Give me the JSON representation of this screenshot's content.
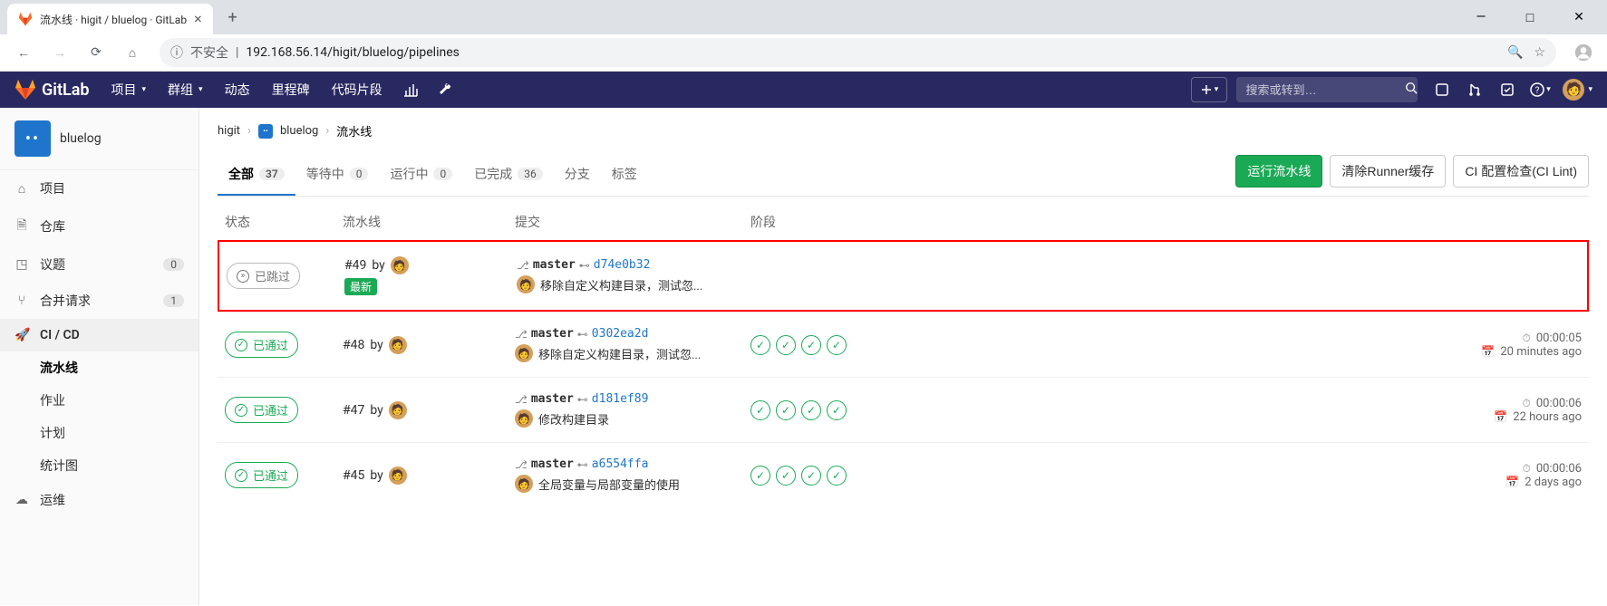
{
  "browser": {
    "tab_title": "流水线 · higit / bluelog · GitLab",
    "insecure_label": "不安全",
    "url": "192.168.56.14/higit/bluelog/pipelines"
  },
  "topbar": {
    "brand": "GitLab",
    "nav": {
      "projects": "项目",
      "groups": "群组",
      "activity": "动态",
      "milestones": "里程碑",
      "snippets": "代码片段"
    },
    "search_placeholder": "搜索或转到…"
  },
  "sidebar": {
    "project_name": "bluelog",
    "items": {
      "project": "项目",
      "repo": "仓库",
      "issues": {
        "label": "议题",
        "count": "0"
      },
      "mrs": {
        "label": "合并请求",
        "count": "1"
      },
      "cicd": "CI / CD",
      "ops": "运维"
    },
    "cicd_sub": {
      "pipelines": "流水线",
      "jobs": "作业",
      "schedules": "计划",
      "charts": "统计图"
    }
  },
  "breadcrumb": {
    "group": "higit",
    "project": "bluelog",
    "page": "流水线"
  },
  "tabs": {
    "all": {
      "label": "全部",
      "count": "37"
    },
    "pending": {
      "label": "等待中",
      "count": "0"
    },
    "running": {
      "label": "运行中",
      "count": "0"
    },
    "finished": {
      "label": "已完成",
      "count": "36"
    },
    "branches": "分支",
    "tags": "标签"
  },
  "buttons": {
    "run": "运行流水线",
    "clear_cache": "清除Runner缓存",
    "ci_lint": "CI 配置检查(CI Lint)"
  },
  "columns": {
    "status": "状态",
    "pipeline": "流水线",
    "commit": "提交",
    "stages": "阶段"
  },
  "status_labels": {
    "skipped": "已跳过",
    "passed": "已通过"
  },
  "latest_label": "最新",
  "by_label": "by",
  "branch_default": "master",
  "pipelines": [
    {
      "status": "skipped",
      "id": "#49",
      "latest": true,
      "highlight": true,
      "sha": "d74e0b32",
      "message": "移除自定义构建目录，测试忽...",
      "stages": 0,
      "duration": "",
      "finished": ""
    },
    {
      "status": "passed",
      "id": "#48",
      "latest": false,
      "highlight": false,
      "sha": "0302ea2d",
      "message": "移除自定义构建目录，测试忽...",
      "stages": 4,
      "duration": "00:00:05",
      "finished": "20 minutes ago"
    },
    {
      "status": "passed",
      "id": "#47",
      "latest": false,
      "highlight": false,
      "sha": "d181ef89",
      "message": "修改构建目录",
      "stages": 4,
      "duration": "00:00:06",
      "finished": "22 hours ago"
    },
    {
      "status": "passed",
      "id": "#45",
      "latest": false,
      "highlight": false,
      "sha": "a6554ffa",
      "message": "全局变量与局部变量的使用",
      "stages": 4,
      "duration": "00:00:06",
      "finished": "2 days ago"
    }
  ]
}
